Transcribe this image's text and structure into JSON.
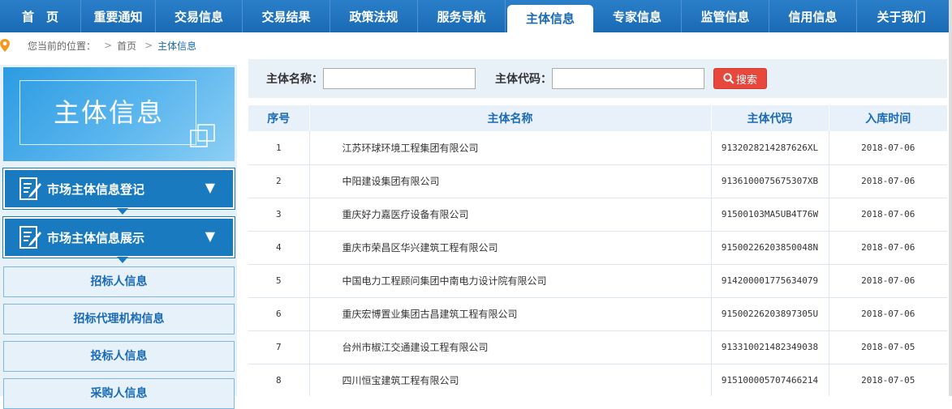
{
  "nav": {
    "items": [
      "首　页",
      "重要通知",
      "交易信息",
      "交易结果",
      "政策法规",
      "服务导航",
      "主体信息",
      "专家信息",
      "监管信息",
      "信用信息",
      "关于我们"
    ],
    "active_index": 6
  },
  "breadcrumb": {
    "prefix": "您当前的位置：",
    "separator": ">",
    "home": "首页",
    "current": "主体信息"
  },
  "sidebar": {
    "banner_title": "主体信息",
    "sections": [
      {
        "label": "市场主体信息登记",
        "icon": "document-edit-icon",
        "state": "collapsed-arrow-down"
      },
      {
        "label": "市场主体信息展示",
        "icon": "document-edit-icon",
        "state": "collapsed-arrow-down"
      }
    ],
    "links": [
      "招标人信息",
      "招标代理机构信息",
      "投标人信息",
      "采购人信息"
    ]
  },
  "search": {
    "name_label": "主体名称：",
    "name_value": "",
    "code_label": "主体代码：",
    "code_value": "",
    "button_label": "搜索",
    "button_icon": "search-icon"
  },
  "table": {
    "headers": [
      "序号",
      "主体名称",
      "主体代码",
      "入库时间"
    ],
    "rows": [
      {
        "idx": "1",
        "name": "江苏环球环境工程集团有限公司",
        "code": "9132028214287626XL",
        "date": "2018-07-06"
      },
      {
        "idx": "2",
        "name": "中阳建设集团有限公司",
        "code": "913610007567530​7XB",
        "date": "2018-07-06"
      },
      {
        "idx": "3",
        "name": "重庆好力嘉医疗设备有限公司",
        "code": "91500103MA5UB4T76W",
        "date": "2018-07-06"
      },
      {
        "idx": "4",
        "name": "重庆市荣昌区华兴建筑工程有限公司",
        "code": "91500226203850048N",
        "date": "2018-07-06"
      },
      {
        "idx": "5",
        "name": "中国电力工程顾问集团中南电力设计院有限公司",
        "code": "914200001775634079",
        "date": "2018-07-06"
      },
      {
        "idx": "6",
        "name": "重庆宏博置业集团古昌建筑工程有限公司",
        "code": "91500226203897305U",
        "date": "2018-07-06"
      },
      {
        "idx": "7",
        "name": "台州市椒江交通建设工程有限公司",
        "code": "913310021482349038",
        "date": "2018-07-05"
      },
      {
        "idx": "8",
        "name": "四川恒宝建筑工程有限公司",
        "code": "915100005707466214",
        "date": "2018-07-05"
      }
    ]
  },
  "colors": {
    "nav_bg": "#1a6ab4",
    "accent_blue": "#1a7ac0",
    "search_button": "#e8483c"
  }
}
